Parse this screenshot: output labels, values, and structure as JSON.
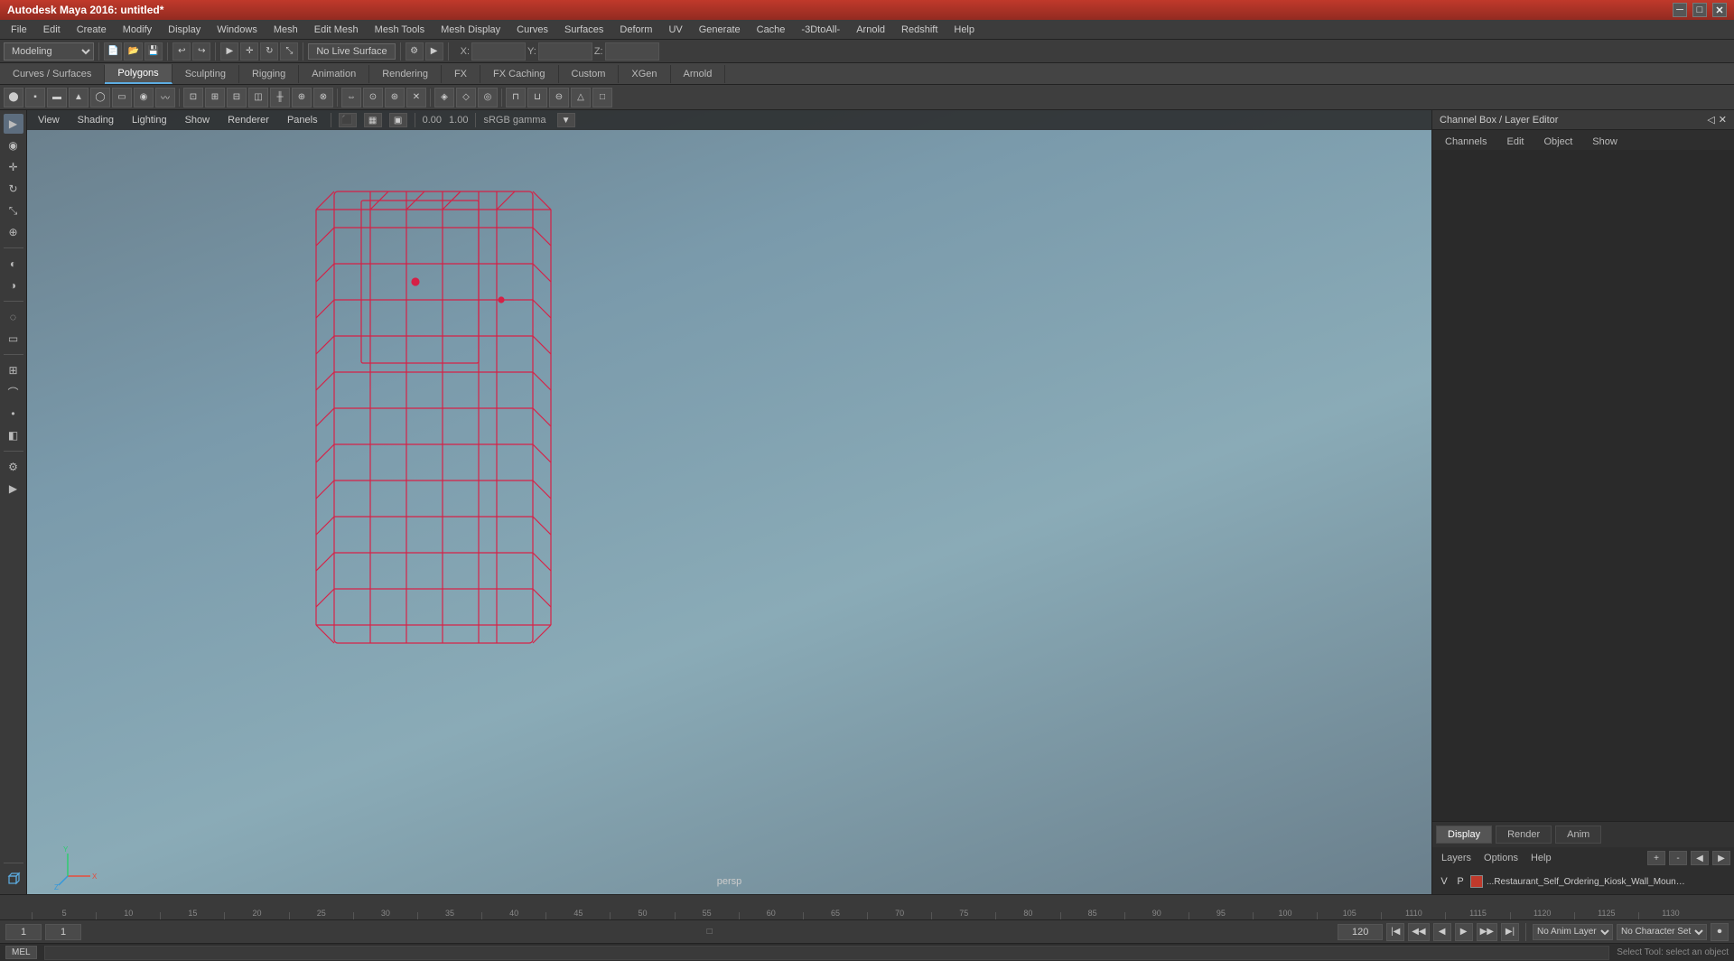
{
  "titlebar": {
    "title": "Autodesk Maya 2016: untitled*",
    "controls": [
      "─",
      "□",
      "✕"
    ]
  },
  "menubar": {
    "items": [
      "File",
      "Edit",
      "Create",
      "Modify",
      "Display",
      "Windows",
      "Mesh",
      "Edit Mesh",
      "Mesh Tools",
      "Mesh Display",
      "Curves",
      "Surfaces",
      "Deform",
      "UV",
      "Generate",
      "Cache",
      "-3DtoAll-",
      "Arnold",
      "Redshift",
      "Help"
    ]
  },
  "toolbar1": {
    "mode": "Modeling",
    "no_live_surface": "No Live Surface",
    "coords": {
      "x": "X:",
      "y": "Y:",
      "z": "Z:"
    }
  },
  "tabbar": {
    "tabs": [
      "Curves / Surfaces",
      "Polygons",
      "Sculpting",
      "Rigging",
      "Animation",
      "Rendering",
      "FX",
      "FX Caching",
      "Custom",
      "XGen",
      "Arnold"
    ],
    "active": "Polygons"
  },
  "viewport": {
    "menus": [
      "View",
      "Shading",
      "Lighting",
      "Show",
      "Renderer",
      "Panels"
    ],
    "label": "persp",
    "gamma": "sRGB gamma"
  },
  "right_panel": {
    "title": "Channel Box / Layer Editor",
    "tabs": [
      "Channels",
      "Edit",
      "Object",
      "Show"
    ],
    "display_tabs": [
      "Display",
      "Render",
      "Anim"
    ],
    "active_display_tab": "Display",
    "layers_menu": [
      "Layers",
      "Options",
      "Help"
    ],
    "layer_row": {
      "v": "V",
      "p": "P",
      "name": "...Restaurant_Self_Ordering_Kiosk_Wall_Mounted"
    }
  },
  "timeline": {
    "ticks": [
      "5",
      "10",
      "15",
      "20",
      "25",
      "30",
      "35",
      "40",
      "45",
      "50",
      "55",
      "60",
      "65",
      "70",
      "75",
      "80",
      "85",
      "90",
      "95",
      "100",
      "105",
      "1110",
      "1115",
      "1120",
      "1125",
      "1130"
    ],
    "start": "1",
    "current_frame": "1",
    "end": "120",
    "anim_layer": "No Anim Layer",
    "character_set": "No Character Set"
  },
  "bottom_bar": {
    "mode_label": "MEL",
    "status": "Select Tool: select an object"
  },
  "colors": {
    "titlebar_top": "#c0392b",
    "titlebar_bottom": "#922b21",
    "accent_blue": "#5dade2",
    "wireframe_color": "#e0143c",
    "layer_color": "#c0392b",
    "viewport_bg_top": "#6a7f8c",
    "viewport_bg_bottom": "#8aabb7"
  }
}
